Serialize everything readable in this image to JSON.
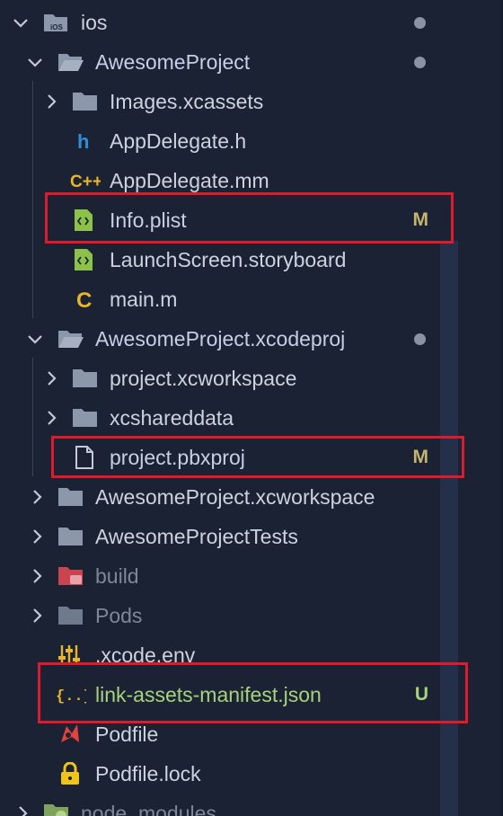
{
  "tree": {
    "rows": [
      {
        "label": "ios",
        "badge": "",
        "dot": true
      },
      {
        "label": "AwesomeProject",
        "badge": "",
        "dot": true
      },
      {
        "label": "Images.xcassets",
        "badge": ""
      },
      {
        "label": "AppDelegate.h",
        "badge": ""
      },
      {
        "label": "AppDelegate.mm",
        "badge": ""
      },
      {
        "label": "Info.plist",
        "badge": "M"
      },
      {
        "label": "LaunchScreen.storyboard",
        "badge": ""
      },
      {
        "label": "main.m",
        "badge": ""
      },
      {
        "label": "AwesomeProject.xcodeproj",
        "badge": "",
        "dot": true
      },
      {
        "label": "project.xcworkspace",
        "badge": ""
      },
      {
        "label": "xcshareddata",
        "badge": ""
      },
      {
        "label": "project.pbxproj",
        "badge": "M"
      },
      {
        "label": "AwesomeProject.xcworkspace",
        "badge": ""
      },
      {
        "label": "AwesomeProjectTests",
        "badge": ""
      },
      {
        "label": "build",
        "badge": ""
      },
      {
        "label": "Pods",
        "badge": ""
      },
      {
        "label": ".xcode.env",
        "badge": ""
      },
      {
        "label": "link-assets-manifest.json",
        "badge": "U"
      },
      {
        "label": "Podfile",
        "badge": ""
      },
      {
        "label": "Podfile.lock",
        "badge": ""
      },
      {
        "label": "node_modules",
        "badge": ""
      }
    ]
  },
  "colors": {
    "background": "#1b2233",
    "highlight_border": "#e2192c",
    "modified_badge": "#c5b56d",
    "untracked": "#a7d27b"
  }
}
